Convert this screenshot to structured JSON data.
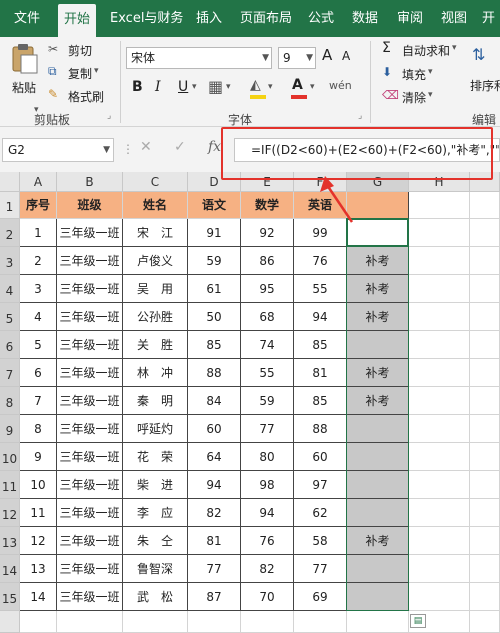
{
  "ribbon": {
    "tabs": [
      "文件",
      "开始",
      "Excel与财务",
      "插入",
      "页面布局",
      "公式",
      "数据",
      "审阅",
      "视图",
      "开"
    ],
    "active_tab": "开始",
    "clipboard": {
      "paste": "粘贴",
      "cut": "剪切",
      "copy": "复制",
      "format_painter": "格式刷",
      "group": "剪贴板"
    },
    "font": {
      "name": "宋体",
      "size": "9",
      "group": "字体",
      "bold": "B",
      "italic": "I",
      "underline": "U",
      "grow": "A",
      "shrink": "A",
      "font_color": "A",
      "fill_label": "wén"
    },
    "editing": {
      "autosum": "自动求和",
      "fill": "填充",
      "clear": "清除",
      "sort": "排序和",
      "group": "编辑"
    },
    "colors": {
      "green": "#227447",
      "red": "#e3322b",
      "header": "#f6b183"
    }
  },
  "formula_bar": {
    "name_box": "G2",
    "fx": "fx",
    "formula": "=IF((D2<60)+(E2<60)+(F2<60),\"补考\",\"\")"
  },
  "sheet": {
    "columns": [
      "A",
      "B",
      "C",
      "D",
      "E",
      "F",
      "G",
      "H"
    ],
    "headers": [
      "序号",
      "班级",
      "姓名",
      "语文",
      "数学",
      "英语",
      ""
    ],
    "rows": [
      [
        "1",
        "三年级一班",
        "宋　江",
        "91",
        "92",
        "99",
        ""
      ],
      [
        "2",
        "三年级一班",
        "卢俊义",
        "59",
        "86",
        "76",
        "补考"
      ],
      [
        "3",
        "三年级一班",
        "吴　用",
        "61",
        "95",
        "55",
        "补考"
      ],
      [
        "4",
        "三年级一班",
        "公孙胜",
        "50",
        "68",
        "94",
        "补考"
      ],
      [
        "5",
        "三年级一班",
        "关　胜",
        "85",
        "74",
        "85",
        ""
      ],
      [
        "6",
        "三年级一班",
        "林　冲",
        "88",
        "55",
        "81",
        "补考"
      ],
      [
        "7",
        "三年级一班",
        "秦　明",
        "84",
        "59",
        "85",
        "补考"
      ],
      [
        "8",
        "三年级一班",
        "呼延灼",
        "60",
        "77",
        "88",
        ""
      ],
      [
        "9",
        "三年级一班",
        "花　荣",
        "64",
        "80",
        "60",
        ""
      ],
      [
        "10",
        "三年级一班",
        "柴　进",
        "94",
        "98",
        "97",
        ""
      ],
      [
        "11",
        "三年级一班",
        "李　应",
        "82",
        "94",
        "62",
        ""
      ],
      [
        "12",
        "三年级一班",
        "朱　仝",
        "81",
        "76",
        "58",
        "补考"
      ],
      [
        "13",
        "三年级一班",
        "鲁智深",
        "77",
        "82",
        "77",
        ""
      ],
      [
        "14",
        "三年级一班",
        "武　松",
        "87",
        "70",
        "69",
        ""
      ]
    ]
  }
}
